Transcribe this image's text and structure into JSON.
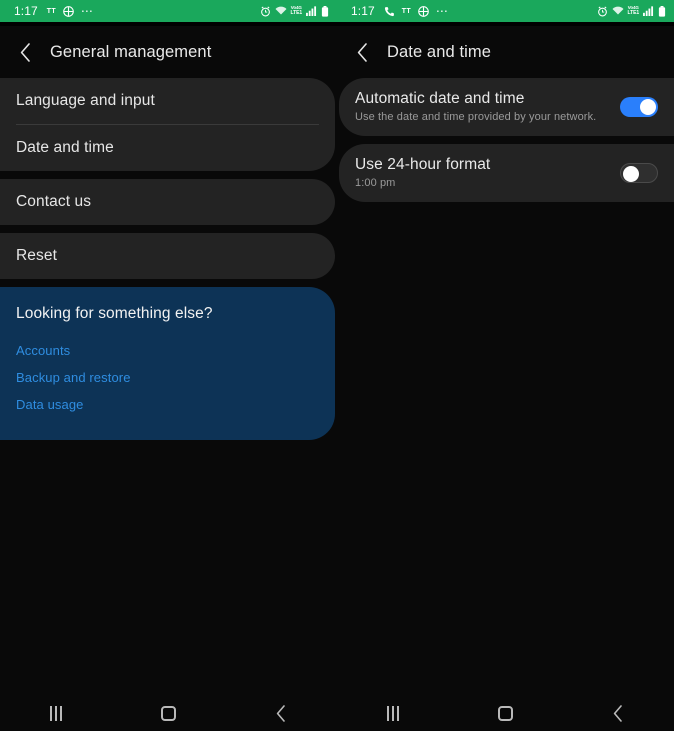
{
  "screens": [
    {
      "id": "general-management",
      "statusbar": {
        "time": "1:17",
        "left_icons": [
          "tt-icon",
          "app-grid-icon",
          "overflow-dots-icon"
        ],
        "tt_label": "TT",
        "dots": "⋯",
        "right_icons": [
          "alarm-icon",
          "wifi-icon",
          "volte-icon",
          "signal-icon",
          "battery-icon"
        ],
        "volte_top": "Vo4G",
        "volte_bottom": "LTE1"
      },
      "header": {
        "back_icon": "back-chevron-icon",
        "title": "General management"
      },
      "cards": [
        {
          "type": "list",
          "items": [
            {
              "label": "Language and input"
            },
            {
              "label": "Date and time"
            }
          ]
        },
        {
          "type": "list",
          "items": [
            {
              "label": "Contact us"
            }
          ]
        },
        {
          "type": "list",
          "items": [
            {
              "label": "Reset"
            }
          ]
        }
      ],
      "promo": {
        "title": "Looking for something else?",
        "links": [
          "Accounts",
          "Backup and restore",
          "Data usage"
        ]
      },
      "navbar": {
        "recents": "recents-icon",
        "home": "home-icon",
        "back": "back-icon"
      }
    },
    {
      "id": "date-and-time",
      "statusbar": {
        "time": "1:17",
        "left_icons": [
          "phone-call-icon",
          "tt-icon",
          "app-grid-icon",
          "overflow-dots-icon"
        ],
        "tt_label": "TT",
        "dots": "⋯",
        "right_icons": [
          "alarm-icon",
          "wifi-icon",
          "volte-icon",
          "signal-icon",
          "battery-icon"
        ],
        "volte_top": "Vo4G",
        "volte_bottom": "LTE1"
      },
      "header": {
        "back_icon": "back-chevron-icon",
        "title": "Date and time"
      },
      "toggles": [
        {
          "title": "Automatic date and time",
          "subtitle": "Use the date and time provided by your network.",
          "state": "on"
        },
        {
          "title": "Use 24-hour format",
          "subtitle": "1:00 pm",
          "state": "off"
        }
      ],
      "navbar": {
        "recents": "recents-icon",
        "home": "home-icon",
        "back": "back-icon"
      }
    }
  ],
  "colors": {
    "statusbar_green": "#1AA85C",
    "card_gray": "#232323",
    "promo_blue": "#0d3356",
    "link_blue": "#2f8de0",
    "toggle_on": "#2a7ffb",
    "background": "#090909"
  }
}
